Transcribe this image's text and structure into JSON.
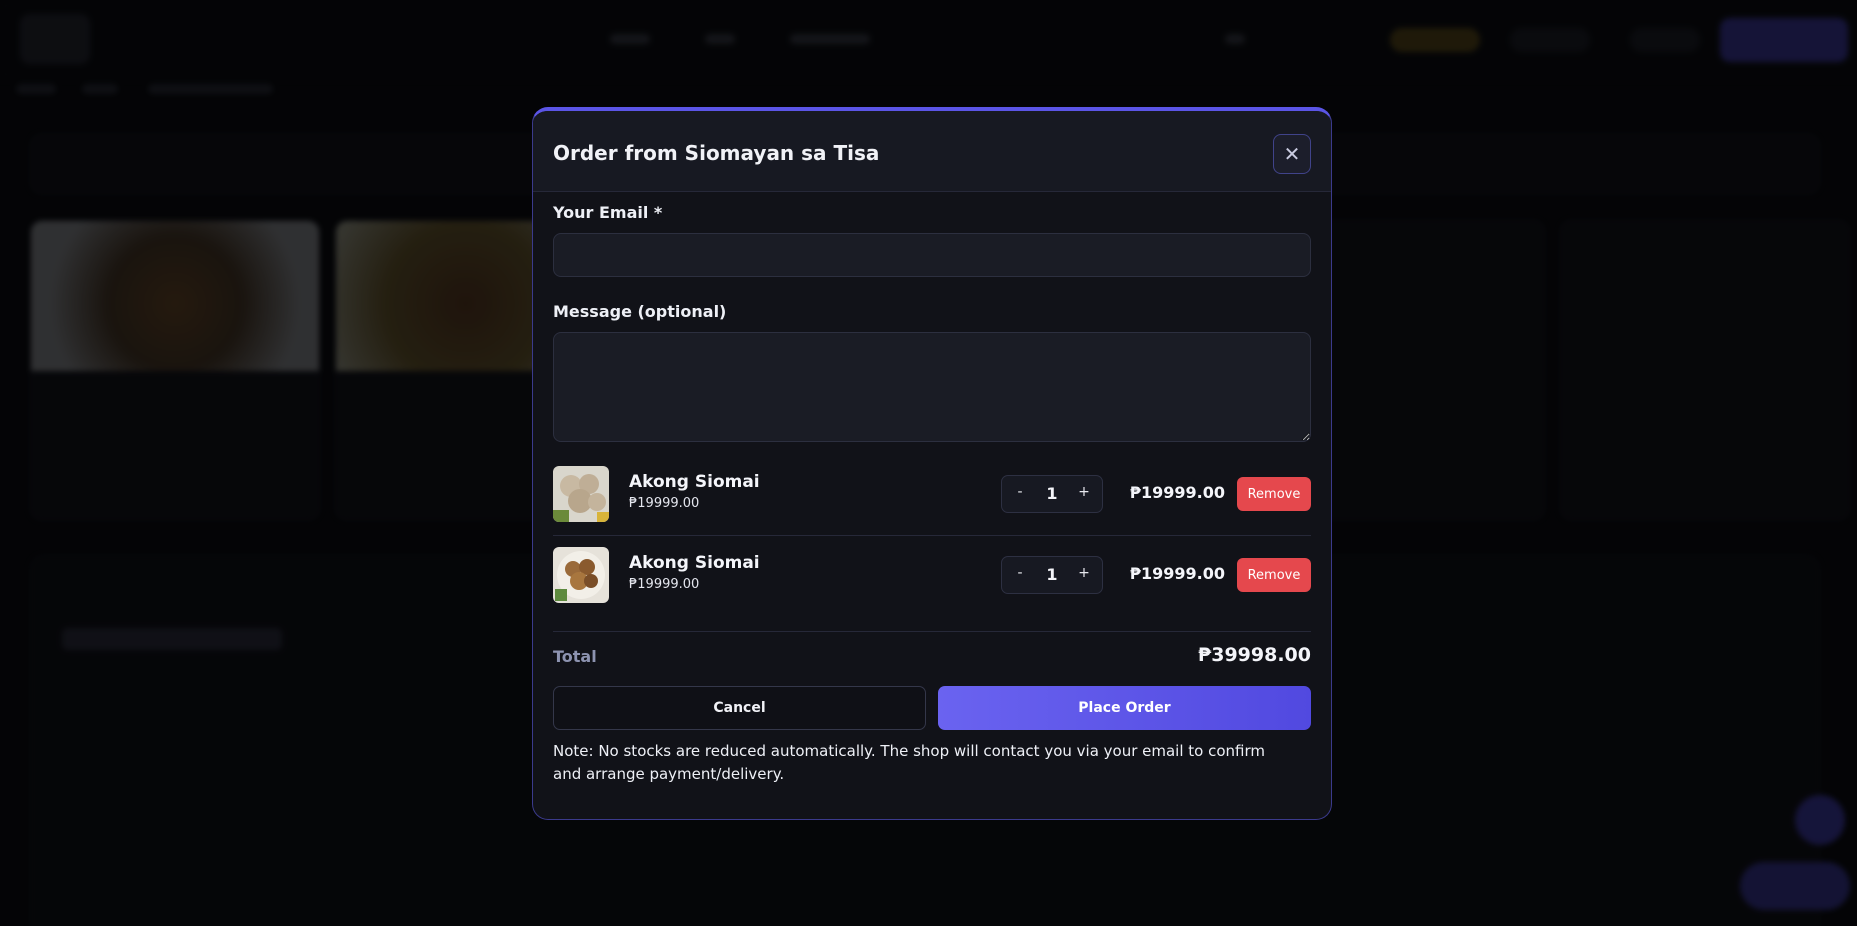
{
  "modal": {
    "title": "Order from Siomayan sa Tisa",
    "close_icon": "close-icon",
    "email_label": "Your Email *",
    "email_value": "",
    "message_label": "Message (optional)",
    "message_value": "",
    "items": [
      {
        "name": "Akong Siomai",
        "price": "₱19999.00",
        "quantity": "1",
        "line_total": "₱19999.00",
        "minus": "-",
        "plus": "+",
        "remove_label": "Remove"
      },
      {
        "name": "Akong Siomai",
        "price": "₱19999.00",
        "quantity": "1",
        "line_total": "₱19999.00",
        "minus": "-",
        "plus": "+",
        "remove_label": "Remove"
      }
    ],
    "total_label": "Total",
    "total_value": "₱39998.00",
    "cancel_label": "Cancel",
    "place_order_label": "Place Order",
    "note": "Note: No stocks are reduced automatically. The shop will contact you via your email to confirm and arrange payment/delivery."
  },
  "colors": {
    "accent": "#5b55e6",
    "remove": "#e5484d",
    "background": "#0b0c10"
  }
}
